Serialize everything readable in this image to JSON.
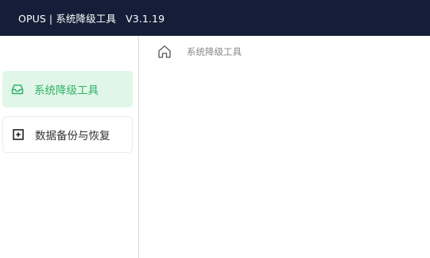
{
  "header": {
    "title": "OPUS | 系统降级工具   V3.1.19"
  },
  "sidebar": {
    "items": [
      {
        "label": "系统降级工具",
        "icon": "inbox-icon",
        "active": true
      },
      {
        "label": "数据备份与恢复",
        "icon": "plus-square-icon",
        "active": false
      }
    ]
  },
  "breadcrumb": {
    "icon": "home-icon",
    "current": "系统降级工具"
  },
  "colors": {
    "header_bg": "#141e38",
    "accent": "#2fb366",
    "active_bg": "#e1f6e8"
  }
}
